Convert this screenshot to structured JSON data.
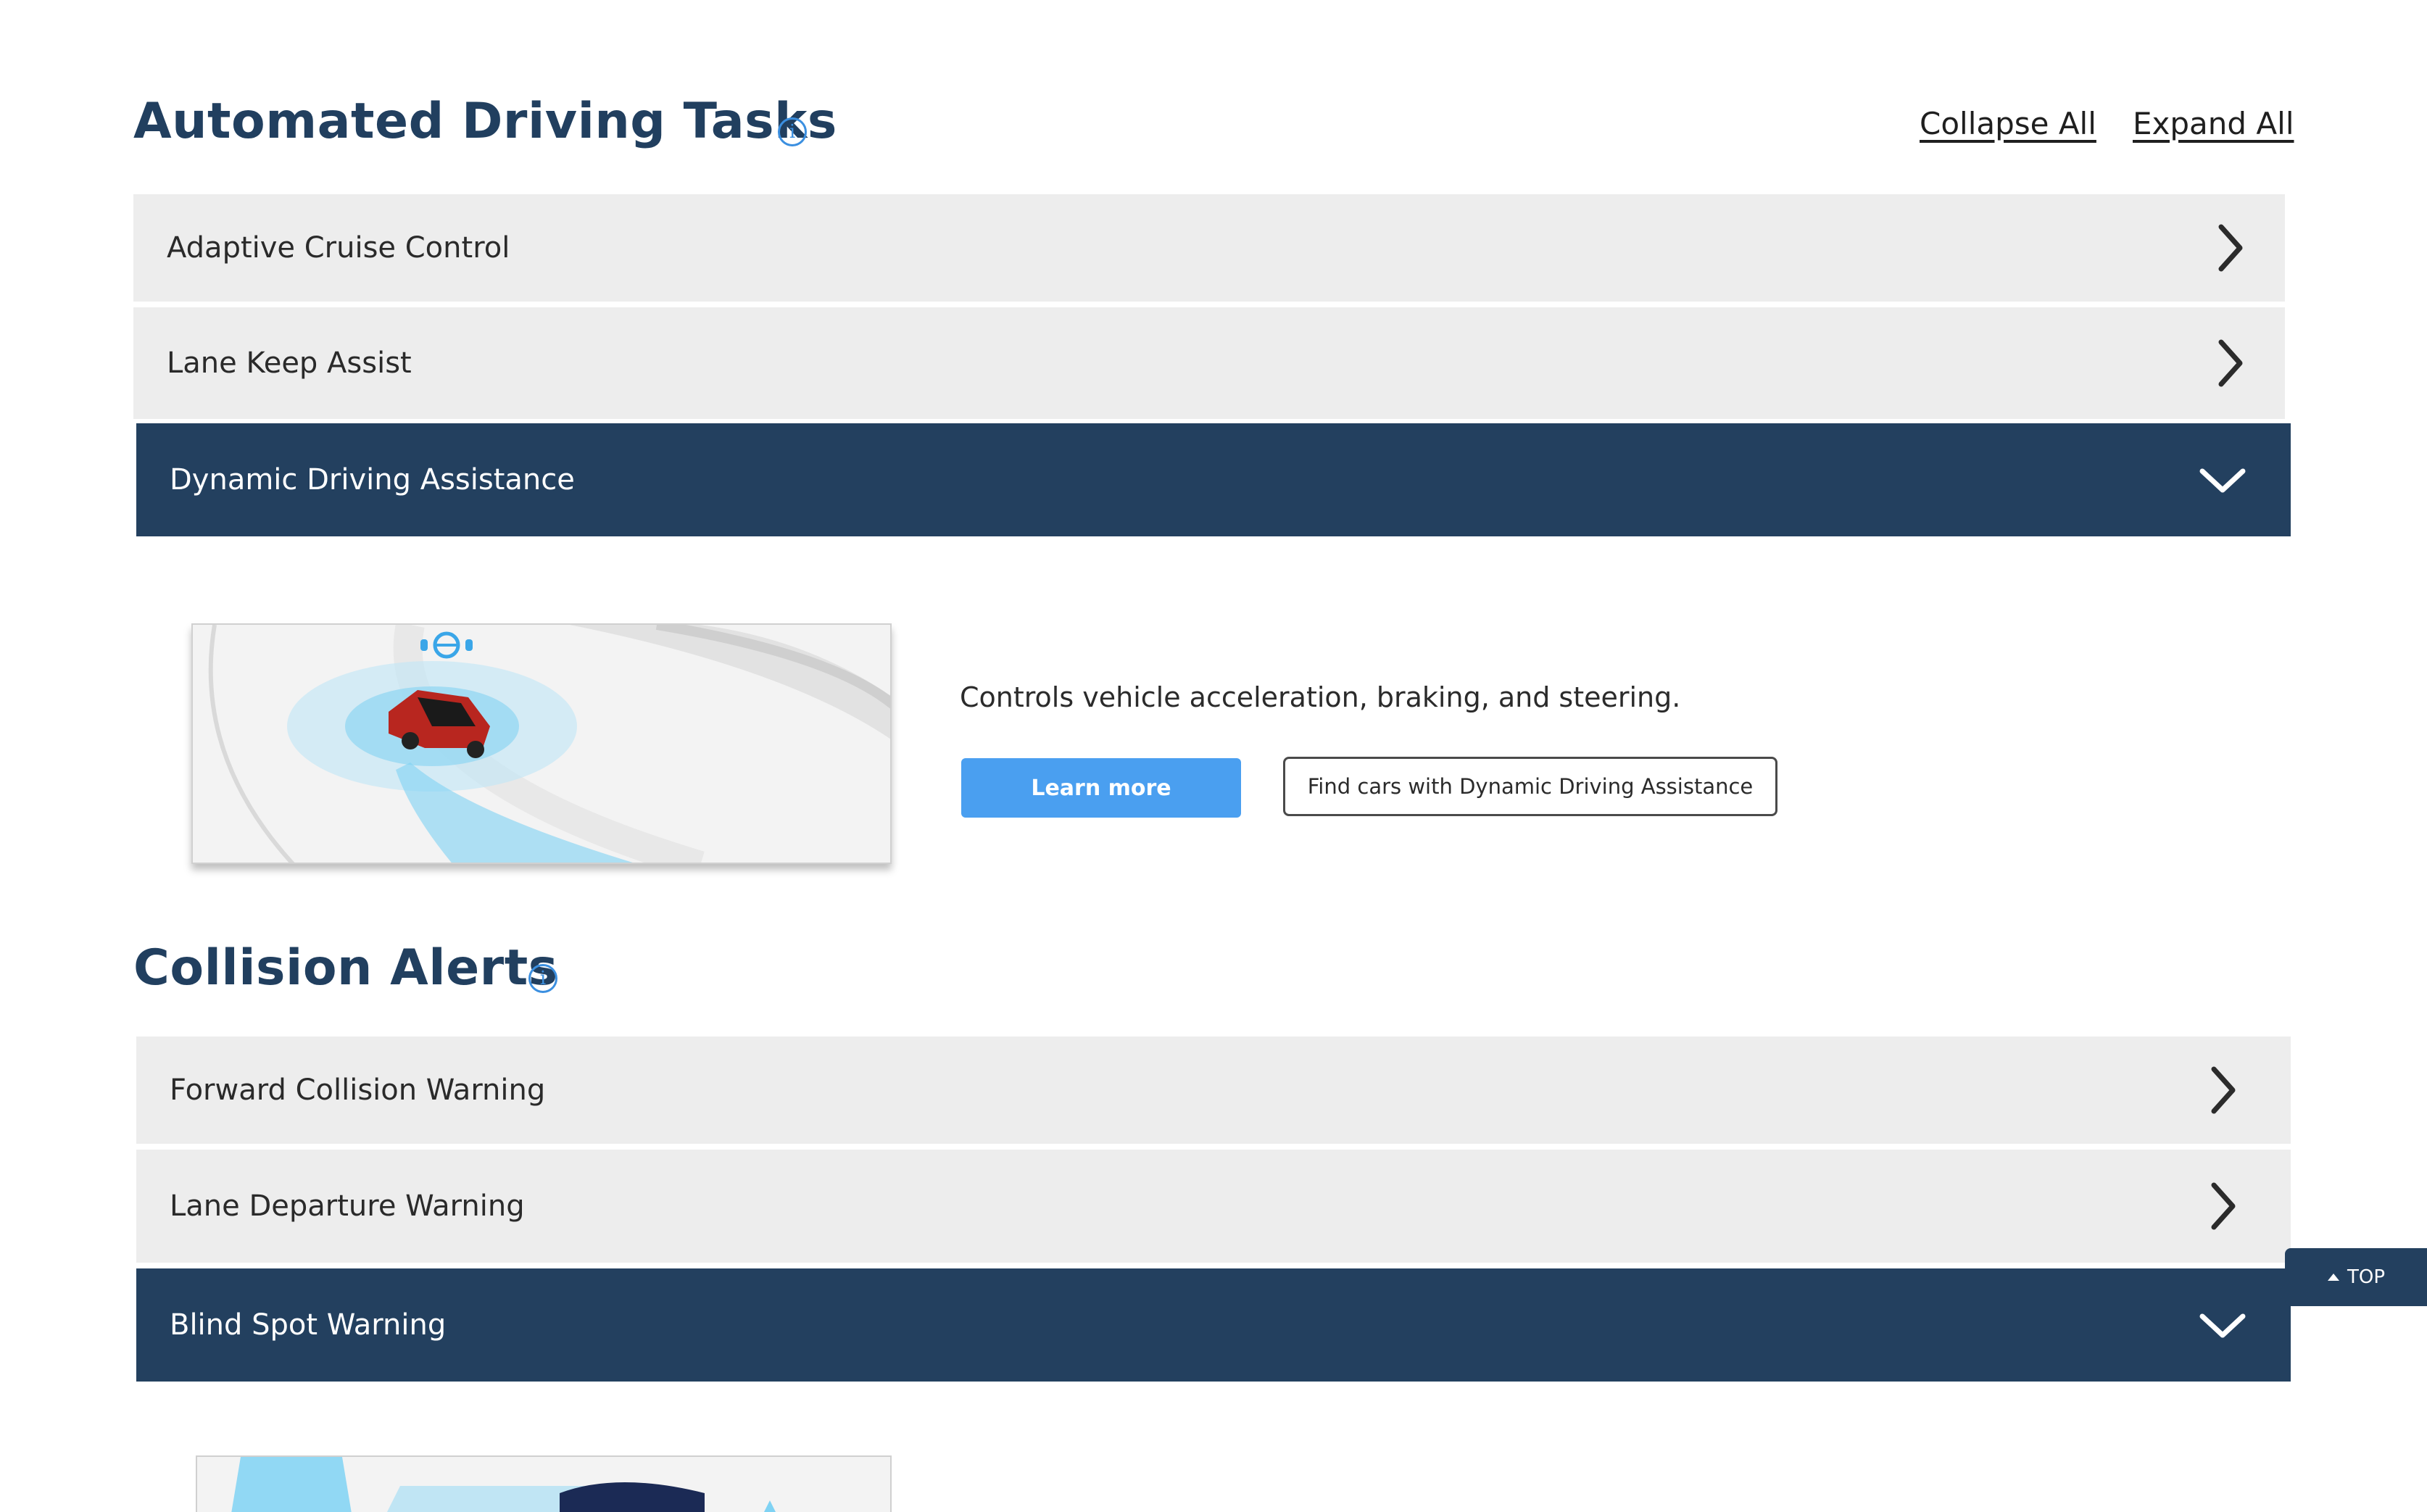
{
  "sections": [
    {
      "title": "Automated Driving Tasks",
      "info_icon": "info-icon",
      "items": [
        {
          "label": "Adaptive Cruise Control",
          "state": "collapsed"
        },
        {
          "label": "Lane Keep Assist",
          "state": "collapsed"
        },
        {
          "label": "Dynamic Driving Assistance",
          "state": "expanded"
        }
      ],
      "expanded": {
        "description": "Controls vehicle acceleration, braking, and steering.",
        "learn_more_label": "Learn more",
        "find_cars_label": "Find cars with Dynamic Driving Assistance"
      }
    },
    {
      "title": "Collision Alerts",
      "info_icon": "info-icon",
      "items": [
        {
          "label": "Forward Collision Warning",
          "state": "collapsed"
        },
        {
          "label": "Lane Departure Warning",
          "state": "collapsed"
        },
        {
          "label": "Blind Spot Warning",
          "state": "expanded"
        }
      ]
    }
  ],
  "controls": {
    "collapse_all": "Collapse All",
    "expand_all": "Expand All",
    "top_button": "TOP"
  },
  "info_glyph": "i",
  "colors": {
    "heading": "#213f5f",
    "expanded_row": "#23405f",
    "collapsed_row": "#ededed",
    "primary_button": "#4a9ff0",
    "info_icon": "#3b8fe0"
  }
}
